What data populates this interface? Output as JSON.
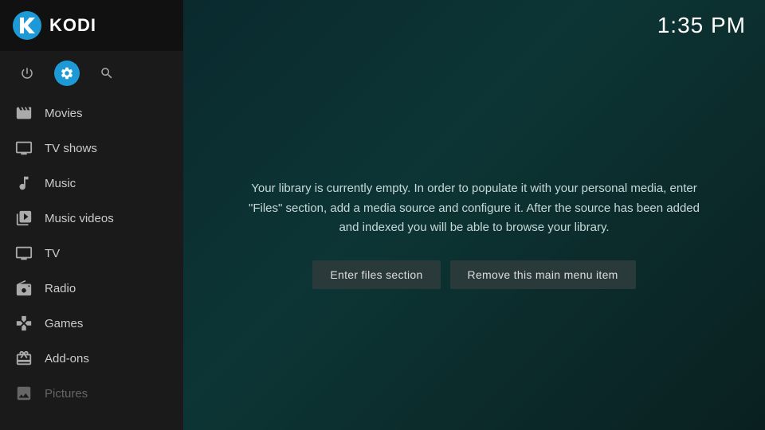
{
  "app": {
    "title": "KODI"
  },
  "clock": "1:35 PM",
  "sidebar": {
    "icons": [
      {
        "name": "power-icon",
        "label": "Power",
        "active": false,
        "symbol": "⏻"
      },
      {
        "name": "settings-icon",
        "label": "Settings",
        "active": true,
        "symbol": "⚙"
      },
      {
        "name": "search-icon",
        "label": "Search",
        "active": false,
        "symbol": "🔍"
      }
    ],
    "items": [
      {
        "id": "movies",
        "label": "Movies",
        "icon": "movies"
      },
      {
        "id": "tv-shows",
        "label": "TV shows",
        "icon": "tvshows"
      },
      {
        "id": "music",
        "label": "Music",
        "icon": "music"
      },
      {
        "id": "music-videos",
        "label": "Music videos",
        "icon": "musicvideos"
      },
      {
        "id": "tv",
        "label": "TV",
        "icon": "tv"
      },
      {
        "id": "radio",
        "label": "Radio",
        "icon": "radio"
      },
      {
        "id": "games",
        "label": "Games",
        "icon": "games"
      },
      {
        "id": "add-ons",
        "label": "Add-ons",
        "icon": "addons"
      },
      {
        "id": "pictures",
        "label": "Pictures",
        "icon": "pictures"
      }
    ]
  },
  "main": {
    "message": "Your library is currently empty. In order to populate it with your personal media, enter \"Files\" section, add a media source and configure it. After the source has been added and indexed you will be able to browse your library.",
    "buttons": [
      {
        "id": "enter-files",
        "label": "Enter files section"
      },
      {
        "id": "remove-menu-item",
        "label": "Remove this main menu item"
      }
    ]
  }
}
